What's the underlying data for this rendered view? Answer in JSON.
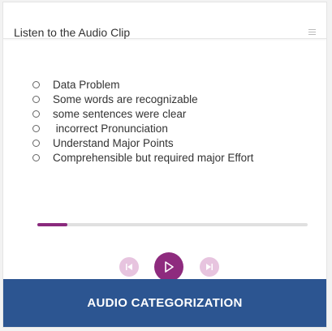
{
  "header": {
    "title": "Listen to the Audio Clip",
    "menu_icon": "menu-icon"
  },
  "options": [
    {
      "label": "Data Problem"
    },
    {
      "label": "Some words are recognizable"
    },
    {
      "label": "some sentences were clear"
    },
    {
      "label": " incorrect Pronunciation"
    },
    {
      "label": "Understand Major Points"
    },
    {
      "label": "Comprehensible but required major Effort"
    }
  ],
  "player": {
    "progress": 0.11,
    "buttons": [
      "previous-icon",
      "play-icon",
      "next-icon"
    ]
  },
  "banner": {
    "label": "AUDIO CATEGORIZATION"
  },
  "colors": {
    "accent": "#8e2b7e",
    "accent_light": "#e7c4df",
    "banner": "#2c5591",
    "track": "#e0e0e0"
  }
}
